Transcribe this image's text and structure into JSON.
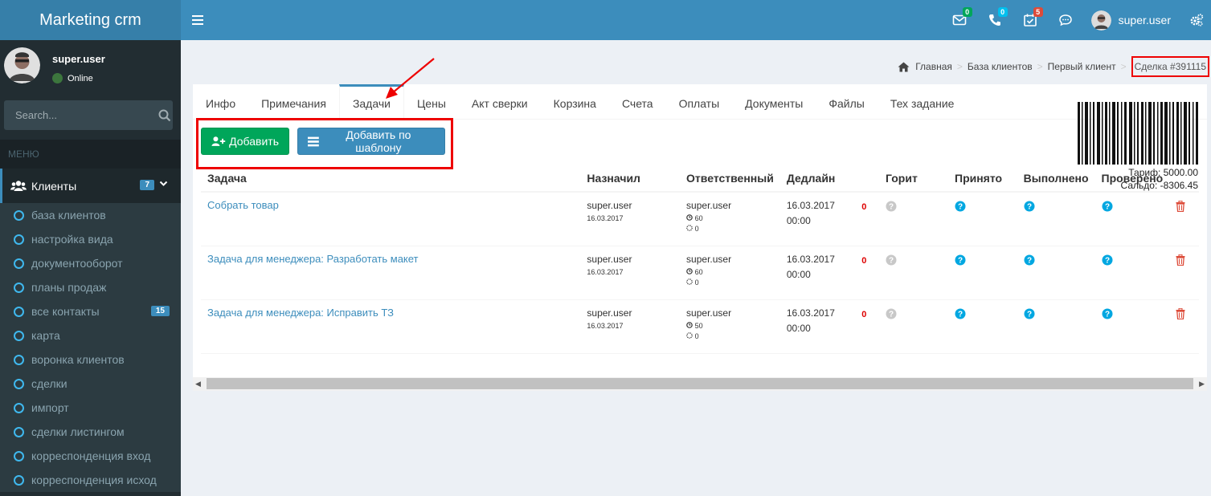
{
  "app": {
    "title": "Marketing crm"
  },
  "navbar": {
    "badges": {
      "mail": "0",
      "phone": "0",
      "tasks": "5"
    },
    "user": "super.user",
    "colors": {
      "mail": "#00a65a",
      "phone": "#00c0ef",
      "tasks": "#dd4b39"
    }
  },
  "sidebar": {
    "user": {
      "name": "super.user",
      "status": "Online"
    },
    "search": {
      "placeholder": "Search..."
    },
    "menu_header": "МЕНЮ",
    "section": {
      "label": "Клиенты",
      "count": "7"
    },
    "items": [
      {
        "label": "база клиентов"
      },
      {
        "label": "настройка вида"
      },
      {
        "label": "документооборот"
      },
      {
        "label": "планы продаж"
      },
      {
        "label": "все контакты",
        "badge": "15"
      },
      {
        "label": "карта"
      },
      {
        "label": "воронка клиентов"
      },
      {
        "label": "сделки"
      },
      {
        "label": "импорт"
      },
      {
        "label": "сделки листингом"
      },
      {
        "label": "корреспонденция вход"
      },
      {
        "label": "корреспонденция исход"
      }
    ]
  },
  "breadcrumb": {
    "home": "Главная",
    "clients": "База клиентов",
    "client": "Первый клиент",
    "deal": "Сделка #391115"
  },
  "tabs": [
    "Инфо",
    "Примечания",
    "Задачи",
    "Цены",
    "Акт сверки",
    "Корзина",
    "Счета",
    "Оплаты",
    "Документы",
    "Файлы",
    "Тех задание"
  ],
  "active_tab": "Задачи",
  "tarif": {
    "tarif": "Тариф: 5000.00",
    "saldo": "Сальдо: -8306.45"
  },
  "buttons": {
    "add": "Добавить",
    "add_template": "Добавить по шаблону"
  },
  "table": {
    "headers": [
      "Задача",
      "Назначил",
      "Ответственный",
      "Дедлайн",
      "",
      "Горит",
      "Принято",
      "Выполнено",
      "Проверено"
    ],
    "rows": [
      {
        "task": "Собрать товар",
        "assigned_by": "super.user",
        "assigned_date": "16.03.2017",
        "responsible": "super.user",
        "time": "60",
        "progress": "0",
        "deadline_date": "16.03.2017",
        "deadline_time": "00:00",
        "overdue": "0"
      },
      {
        "task": "Задача для менеджера: Разработать макет",
        "assigned_by": "super.user",
        "assigned_date": "16.03.2017",
        "responsible": "super.user",
        "time": "60",
        "progress": "0",
        "deadline_date": "16.03.2017",
        "deadline_time": "00:00",
        "overdue": "0"
      },
      {
        "task": "Задача для менеджера: Исправить ТЗ",
        "assigned_by": "super.user",
        "assigned_date": "16.03.2017",
        "responsible": "super.user",
        "time": "50",
        "progress": "0",
        "deadline_date": "16.03.2017",
        "deadline_time": "00:00",
        "overdue": "0"
      }
    ]
  }
}
